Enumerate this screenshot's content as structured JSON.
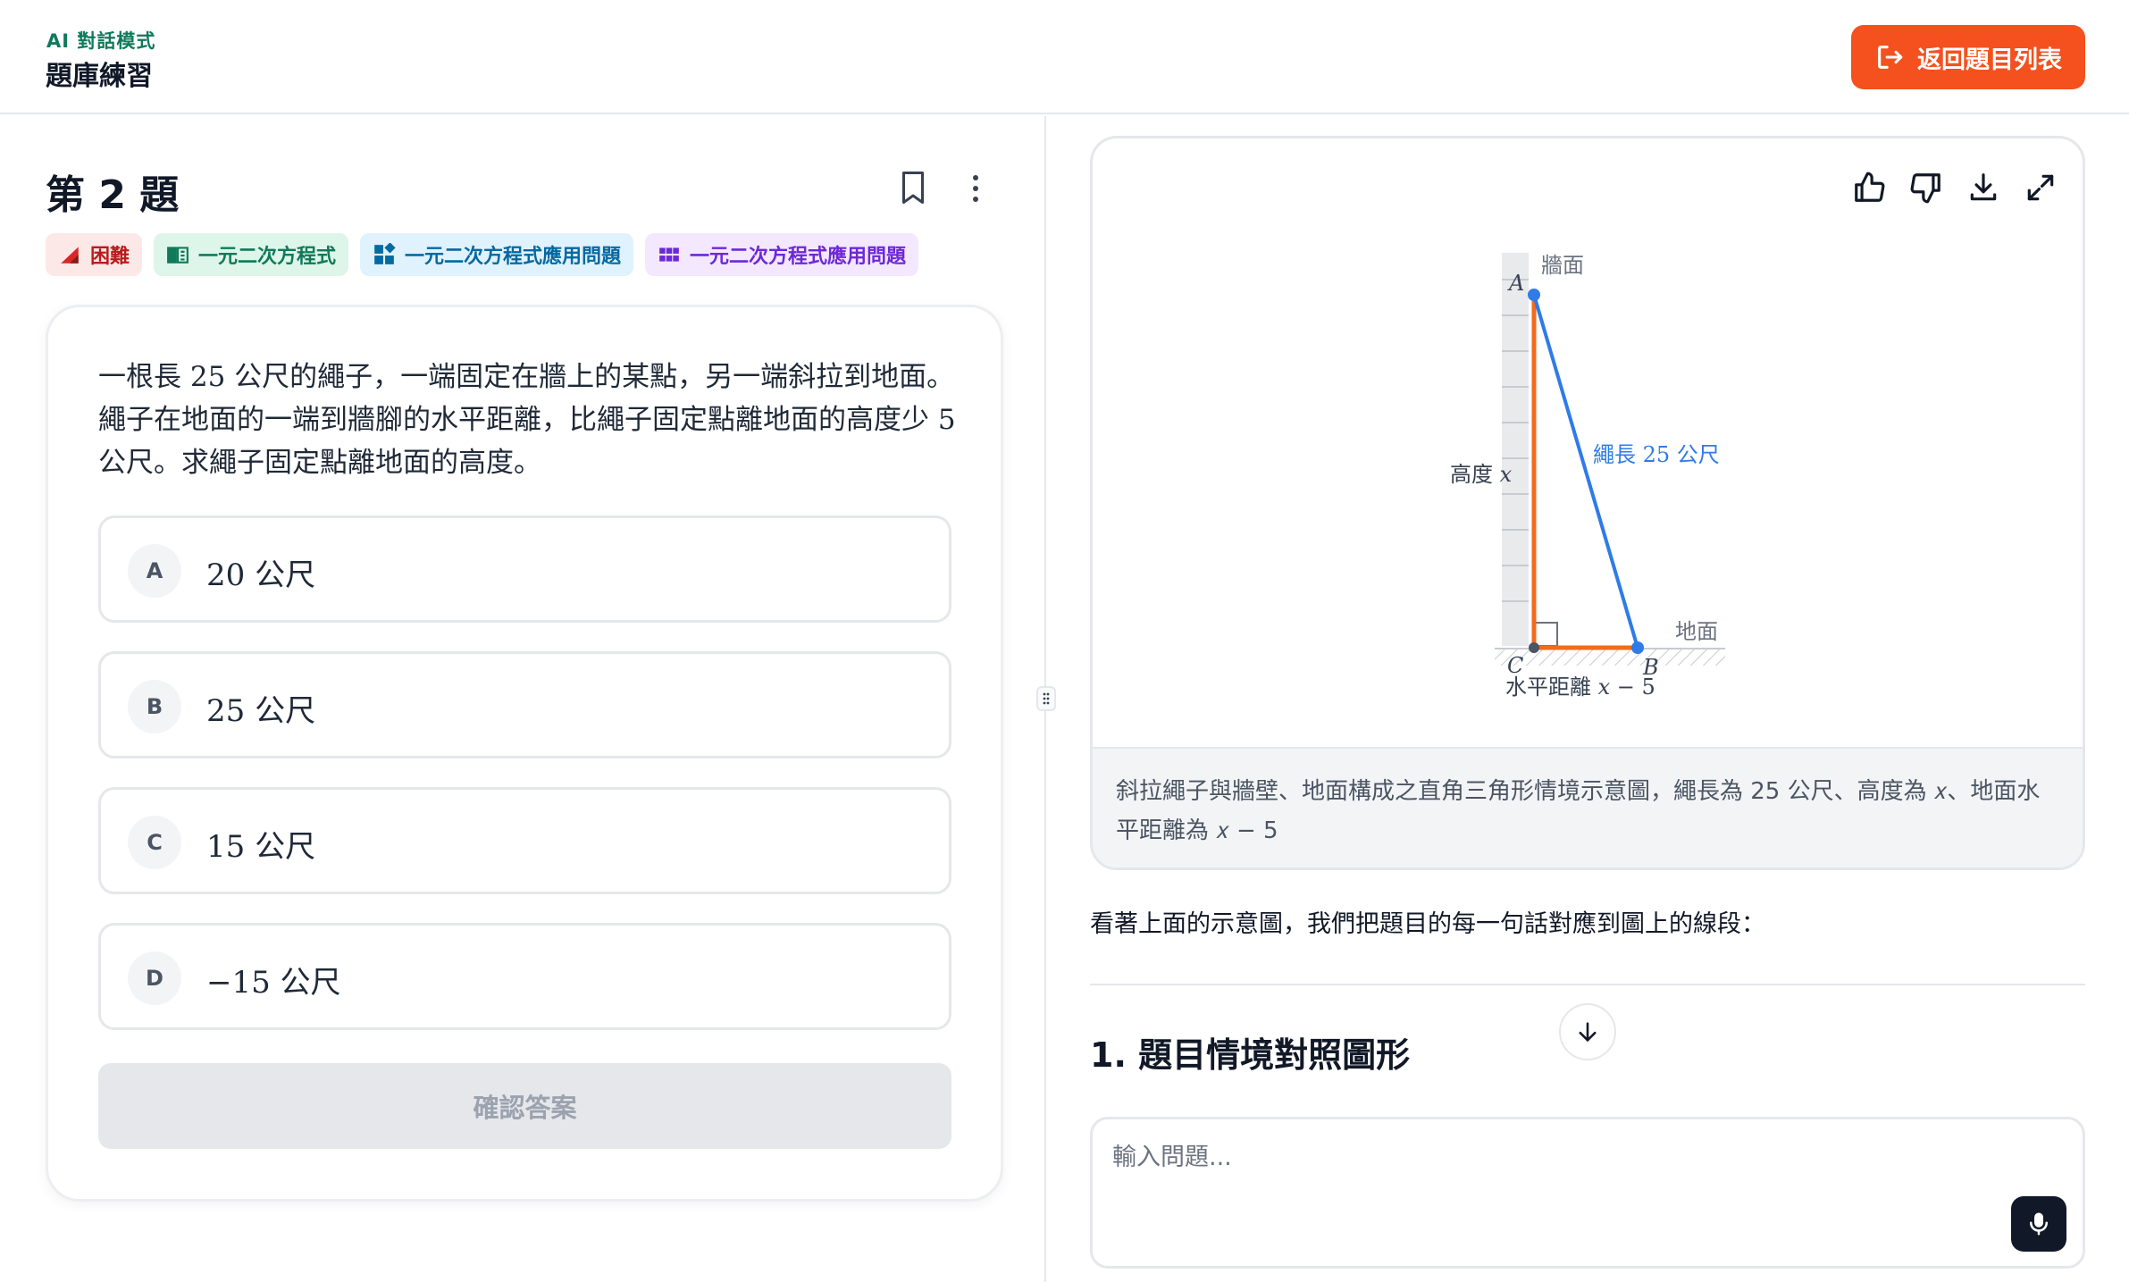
{
  "header": {
    "mode_label": "AI 對話模式",
    "title": "題庫練習",
    "back_button": "返回題目列表"
  },
  "question": {
    "title": "第 2 題",
    "tags": [
      {
        "label": "困難",
        "icon": "difficulty-icon"
      },
      {
        "label": "一元二次方程式",
        "icon": "book-icon"
      },
      {
        "label": "一元二次方程式應用問題",
        "icon": "shapes-icon"
      },
      {
        "label": "一元二次方程式應用問題",
        "icon": "grid-icon"
      }
    ],
    "text": "一根長 25 公尺的繩子，一端固定在牆上的某點，另一端斜拉到地面。繩子在地面的一端到牆腳的水平距離，比繩子固定點離地面的高度少 5 公尺。求繩子固定點離地面的高度。",
    "options": [
      {
        "letter": "A",
        "text": "20 公尺"
      },
      {
        "letter": "B",
        "text": "25 公尺"
      },
      {
        "letter": "C",
        "text": "15 公尺"
      },
      {
        "letter": "D",
        "text": "−15 公尺"
      }
    ],
    "confirm_button": "確認答案"
  },
  "figure": {
    "labels": {
      "wall": "牆面",
      "ground": "地面",
      "point_a": "A",
      "point_b": "B",
      "point_c": "C",
      "height": "高度 𝑥",
      "rope": "繩長 25 公尺",
      "horizontal": "水平距離 𝑥 − 5"
    },
    "caption": "斜拉繩子與牆壁、地面構成之直角三角形情境示意圖，繩長為 25 公尺、高度為 𝑥、地面水平距離為 𝑥 − 5",
    "colors": {
      "rope": "#2f7be8",
      "legs": "#f36a1d",
      "wall": "#e5e7eb"
    }
  },
  "chat": {
    "explain": "看著上面的示意圖，我們把題目的每一句話對應到圖上的線段：",
    "section_heading": "1. 題目情境對照圖形",
    "input_placeholder": "輸入問題..."
  },
  "colors": {
    "accent": "#f4511e",
    "brand_green": "#0f7a5a"
  }
}
